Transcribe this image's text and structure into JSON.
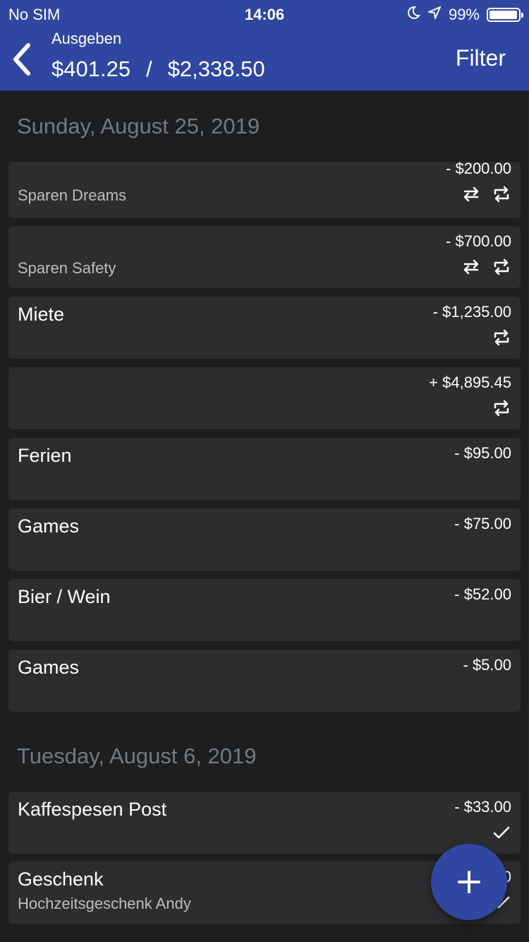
{
  "status_bar": {
    "carrier": "No SIM",
    "time": "14:06",
    "battery": "99%",
    "icons": [
      "moon-icon",
      "location-arrow-icon",
      "battery-icon"
    ]
  },
  "header": {
    "subtitle": "Ausgeben",
    "spent": "$401.25",
    "separator": "/",
    "budget": "$2,338.50",
    "filter_label": "Filter",
    "back_icon": "chevron-left-icon"
  },
  "sections": [
    {
      "date": "Sunday, August 25, 2019",
      "items": [
        {
          "title": "",
          "subtitle": "Sparen Dreams",
          "amount": "- $200.00",
          "icons": [
            "transfer-icon",
            "repeat-icon"
          ]
        },
        {
          "title": "",
          "subtitle": "Sparen Safety",
          "amount": "- $700.00",
          "icons": [
            "transfer-icon",
            "repeat-icon"
          ]
        },
        {
          "title": "Miete",
          "subtitle": "",
          "amount": "- $1,235.00",
          "icons": [
            "repeat-icon"
          ]
        },
        {
          "title": "",
          "subtitle": "",
          "amount": "+ $4,895.45",
          "icons": [
            "repeat-icon"
          ]
        },
        {
          "title": "Ferien",
          "subtitle": "",
          "amount": "- $95.00",
          "icons": []
        },
        {
          "title": "Games",
          "subtitle": "",
          "amount": "- $75.00",
          "icons": []
        },
        {
          "title": "Bier / Wein",
          "subtitle": "",
          "amount": "- $52.00",
          "icons": []
        },
        {
          "title": "Games",
          "subtitle": "",
          "amount": "- $5.00",
          "icons": []
        }
      ]
    },
    {
      "date": "Tuesday, August 6, 2019",
      "items": [
        {
          "title": "Kaffespesen Post",
          "subtitle": "",
          "amount": "- $33.00",
          "icons": [
            "checkmark-icon"
          ]
        },
        {
          "title": "Geschenk",
          "subtitle": "Hochzeitsgeschenk Andy",
          "amount": "0",
          "icons": [
            "checkmark-icon"
          ]
        }
      ]
    }
  ],
  "fab": {
    "icon": "plus-icon"
  },
  "colors": {
    "primary": "#2f47a0",
    "background": "#1e1e1e",
    "card": "#2d2d30",
    "date_header": "#6e7a88"
  }
}
